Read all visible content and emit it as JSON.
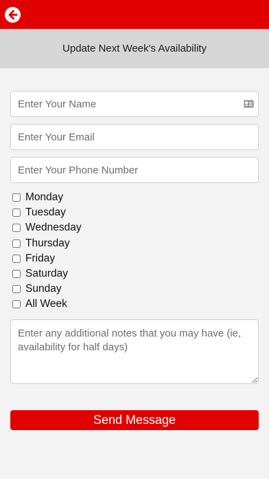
{
  "colors": {
    "accent": "#e00000",
    "header_bg": "#d6d6d6",
    "page_bg": "#f3f3f3"
  },
  "topbar": {
    "back_icon": "back-arrow-icon"
  },
  "header": {
    "title": "Update Next Week's Availability"
  },
  "form": {
    "name_placeholder": "Enter Your Name",
    "name_icon": "contact-card-icon",
    "email_placeholder": "Enter Your Email",
    "phone_placeholder": "Enter Your Phone Number",
    "days": [
      {
        "label": "Monday",
        "checked": false
      },
      {
        "label": "Tuesday",
        "checked": false
      },
      {
        "label": "Wednesday",
        "checked": false
      },
      {
        "label": "Thursday",
        "checked": false
      },
      {
        "label": "Friday",
        "checked": false
      },
      {
        "label": "Saturday",
        "checked": false
      },
      {
        "label": "Sunday",
        "checked": false
      },
      {
        "label": "All Week",
        "checked": false
      }
    ],
    "notes_placeholder": "Enter any additional notes that you may have (ie, availability for half days)",
    "submit_label": "Send Message"
  }
}
